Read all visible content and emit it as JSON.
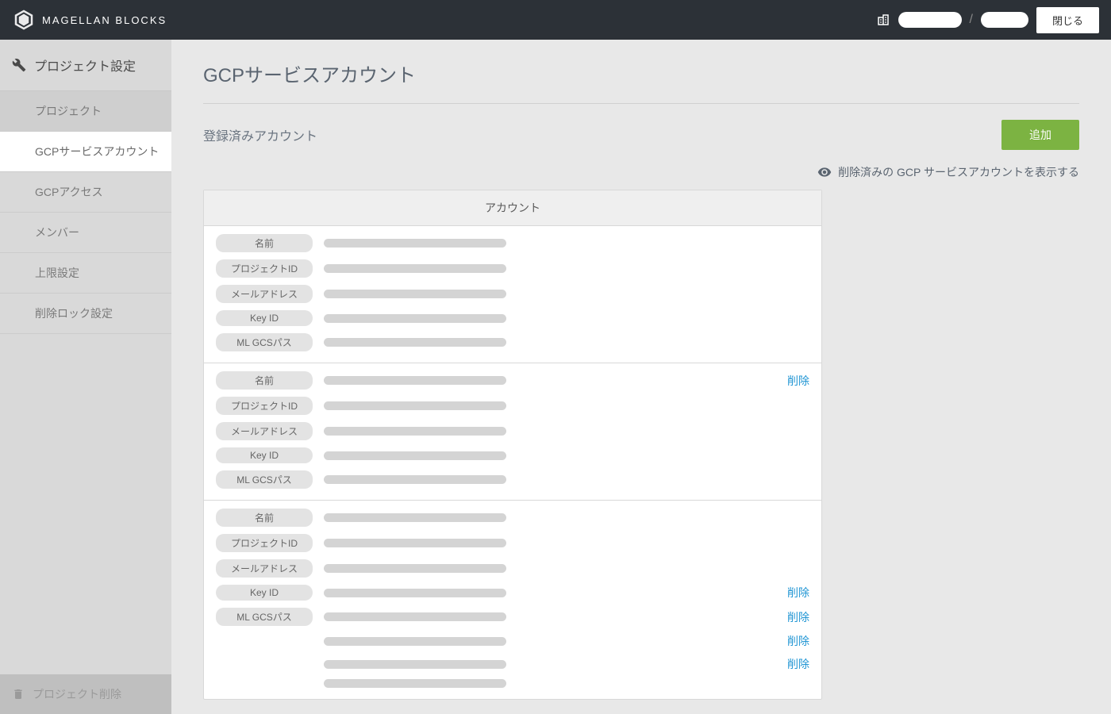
{
  "header": {
    "brand": "MAGELLAN BLOCKS",
    "separator": "/",
    "close_label": "閉じる"
  },
  "sidebar": {
    "title": "プロジェクト設定",
    "items": [
      {
        "label": "プロジェクト",
        "state": "hover"
      },
      {
        "label": "GCPサービスアカウント",
        "state": "active"
      },
      {
        "label": "GCPアクセス",
        "state": ""
      },
      {
        "label": "メンバー",
        "state": ""
      },
      {
        "label": "上限設定",
        "state": ""
      },
      {
        "label": "削除ロック設定",
        "state": ""
      }
    ],
    "footer_label": "プロジェクト削除"
  },
  "main": {
    "page_title": "GCPサービスアカウント",
    "section_title": "登録済みアカウント",
    "add_label": "追加",
    "toggle_deleted_label": "削除済みの GCP サービスアカウントを表示する",
    "table_header": "アカウント",
    "field_labels": {
      "name": "名前",
      "project_id": "プロジェクトID",
      "email": "メールアドレス",
      "key_id": "Key ID",
      "ml_gcs_path": "ML GCSパス"
    },
    "delete_label": "削除",
    "accounts": [
      {
        "delete_rows": []
      },
      {
        "delete_rows": [
          0
        ]
      },
      {
        "delete_rows": [
          3,
          4,
          5,
          6
        ]
      }
    ]
  }
}
